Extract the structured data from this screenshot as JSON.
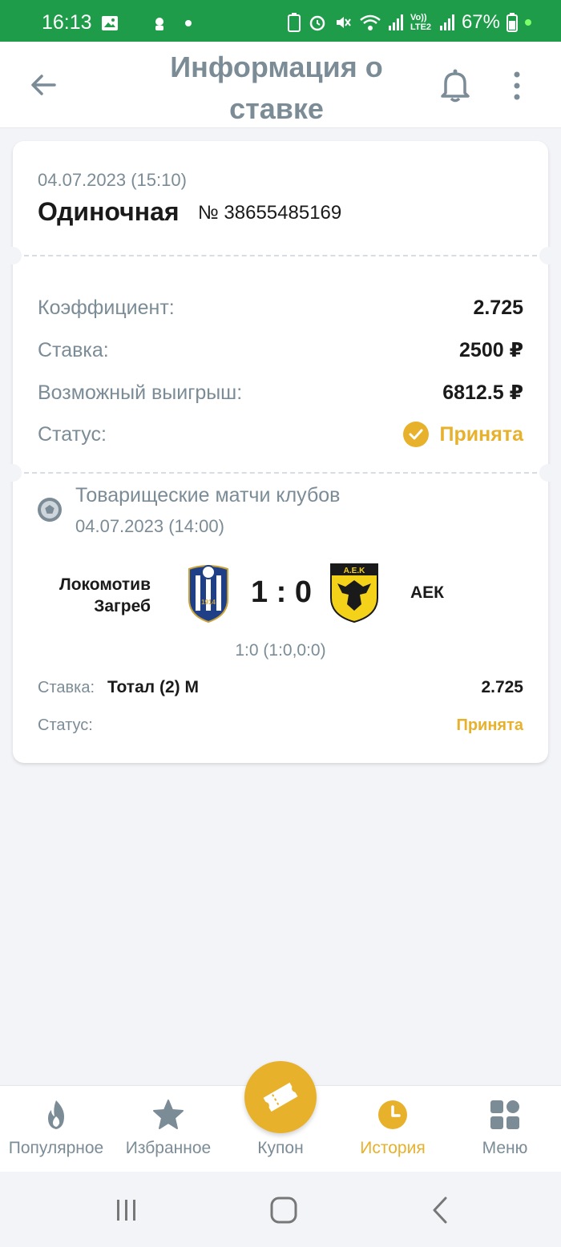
{
  "status_bar": {
    "time": "16:13",
    "battery": "67%",
    "network_label": "Vo)) LTE2"
  },
  "appbar": {
    "title": "Информация о ставке"
  },
  "bet": {
    "date": "04.07.2023 (15:10)",
    "type": "Одиночная",
    "number": "№ 38655485169",
    "rows": [
      {
        "label": "Коэффициент:",
        "value": "2.725"
      },
      {
        "label": "Ставка:",
        "value": "2500 ₽"
      },
      {
        "label": "Возможный выигрыш:",
        "value": "6812.5 ₽"
      },
      {
        "label": "Статус:",
        "value": "Принята"
      }
    ]
  },
  "event": {
    "league": "Товарищеские матчи клубов",
    "date": "04.07.2023 (14:00)",
    "home_team": "Локомотив Загреб",
    "away_team": "АЕК",
    "score": "1 : 0",
    "score_details": "1:0 (1:0,0:0)",
    "bet_label": "Ставка:",
    "bet_pick": "Тотал (2) М",
    "bet_odd": "2.725",
    "status_label": "Статус:",
    "status_value": "Принята",
    "home_logo_text": "1914",
    "away_logo_text": "Α.Ε.Κ"
  },
  "bottom_nav": {
    "items": [
      {
        "label": "Популярное",
        "icon": "flame-icon"
      },
      {
        "label": "Избранное",
        "icon": "star-icon"
      },
      {
        "label": "Купон",
        "icon": "ticket-icon"
      },
      {
        "label": "История",
        "icon": "clock-icon"
      },
      {
        "label": "Меню",
        "icon": "grid-icon"
      }
    ]
  },
  "colors": {
    "status_bar": "#1f9c4a",
    "accent": "#e8b12c",
    "muted_text": "#7b8c97",
    "background": "#f3f4f8"
  }
}
